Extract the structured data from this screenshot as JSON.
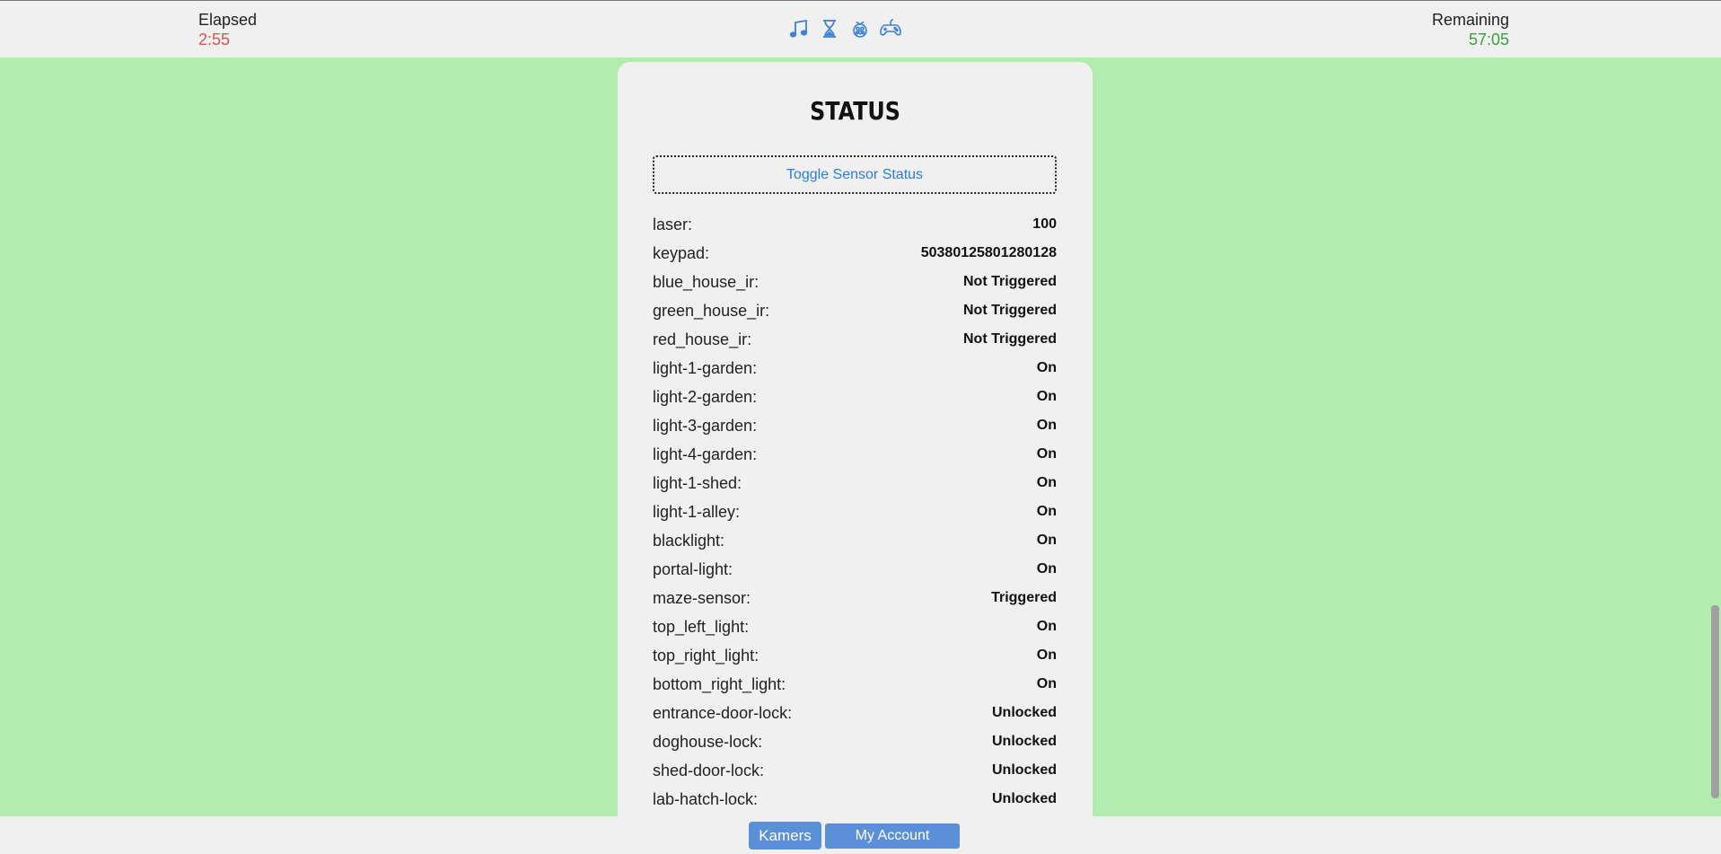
{
  "header": {
    "elapsed_label": "Elapsed",
    "elapsed_value": "2:55",
    "remaining_label": "Remaining",
    "remaining_value": "57:05",
    "icons": [
      "music-icon",
      "hourglass-icon",
      "raspberry-icon",
      "gamepad-icon"
    ]
  },
  "panel": {
    "title": "STATUS",
    "toggle_label": "Toggle Sensor Status",
    "rows": [
      {
        "key": "laser:",
        "value": "100"
      },
      {
        "key": "keypad:",
        "value": "50380125801280128"
      },
      {
        "key": "blue_house_ir:",
        "value": "Not Triggered"
      },
      {
        "key": "green_house_ir:",
        "value": "Not Triggered"
      },
      {
        "key": "red_house_ir:",
        "value": "Not Triggered"
      },
      {
        "key": "light-1-garden:",
        "value": "On"
      },
      {
        "key": "light-2-garden:",
        "value": "On"
      },
      {
        "key": "light-3-garden:",
        "value": "On"
      },
      {
        "key": "light-4-garden:",
        "value": "On"
      },
      {
        "key": "light-1-shed:",
        "value": "On"
      },
      {
        "key": "light-1-alley:",
        "value": "On"
      },
      {
        "key": "blacklight:",
        "value": "On"
      },
      {
        "key": "portal-light:",
        "value": "On"
      },
      {
        "key": "maze-sensor:",
        "value": "Triggered"
      },
      {
        "key": "top_left_light:",
        "value": "On"
      },
      {
        "key": "top_right_light:",
        "value": "On"
      },
      {
        "key": "bottom_right_light:",
        "value": "On"
      },
      {
        "key": "entrance-door-lock:",
        "value": "Unlocked"
      },
      {
        "key": "doghouse-lock:",
        "value": "Unlocked"
      },
      {
        "key": "shed-door-lock:",
        "value": "Unlocked"
      },
      {
        "key": "lab-hatch-lock:",
        "value": "Unlocked"
      }
    ]
  },
  "footer": {
    "kamers_label": "Kamers",
    "account_label": "My Account"
  },
  "colors": {
    "background": "#b2edaf",
    "panel": "#f0f0f0",
    "accent": "#2a7de1",
    "button": "#5b8fd8",
    "elapsed": "#e05050",
    "remaining": "#3e9e3e"
  }
}
